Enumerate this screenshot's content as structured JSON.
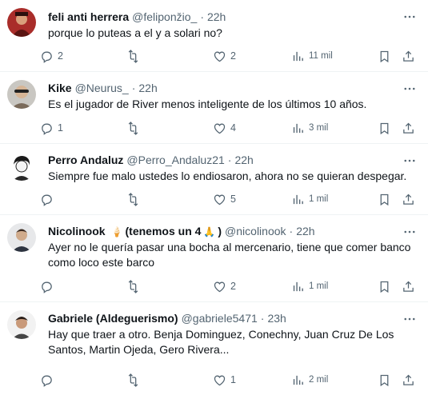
{
  "tweets": [
    {
      "name": "feli anti herrera",
      "handle": "@feliponžio_",
      "time": "22h",
      "text": "porque lo puteas a el y a solari no?",
      "replies": "2",
      "retweets": "",
      "likes": "2",
      "views": "11 mil",
      "avatar_icon": "avatar-photo-icon"
    },
    {
      "name": "Kike",
      "handle": "@Neurus_",
      "time": "22h",
      "text": "Es el jugador de River menos inteligente de los últimos 10 años.",
      "replies": "1",
      "retweets": "",
      "likes": "4",
      "views": "3 mil",
      "avatar_icon": "avatar-photo-icon"
    },
    {
      "name": "Perro Andaluz",
      "handle": "@Perro_Andaluz21",
      "time": "22h",
      "text": "Siempre fue malo ustedes lo endiosaron, ahora no se quieran despegar.",
      "replies": "",
      "retweets": "",
      "likes": "5",
      "views": "1 mil",
      "avatar_icon": "avatar-sketch-icon"
    },
    {
      "name": "Nicolinook",
      "name_suffix": "(tenemos un 4",
      "name_suffix_end": ")",
      "handle": "@nicolinook",
      "time": "22h",
      "text": "Ayer no le quería pasar una bocha al mercenario, tiene que comer banco como loco este barco",
      "replies": "",
      "retweets": "",
      "likes": "2",
      "views": "1 mil",
      "avatar_icon": "avatar-photo-icon"
    },
    {
      "name": "Gabriele (Aldeguerismo)",
      "handle": "@gabriele5471",
      "time": "23h",
      "text": "Hay que traer a otro. Benja Dominguez, Conechny, Juan Cruz De Los Santos, Martin Ojeda, Gero Rivera...",
      "replies": "",
      "retweets": "",
      "likes": "1",
      "views": "2 mil",
      "avatar_icon": "avatar-photo-icon"
    }
  ],
  "colors": {
    "text": "#0f1419",
    "muted": "#536471",
    "divider": "#eff3f4"
  },
  "icons": {
    "reply": "reply-icon",
    "retweet": "retweet-icon",
    "like": "heart-icon",
    "views": "views-chart-icon",
    "bookmark": "bookmark-icon",
    "share": "share-icon",
    "more": "more-options-icon"
  }
}
